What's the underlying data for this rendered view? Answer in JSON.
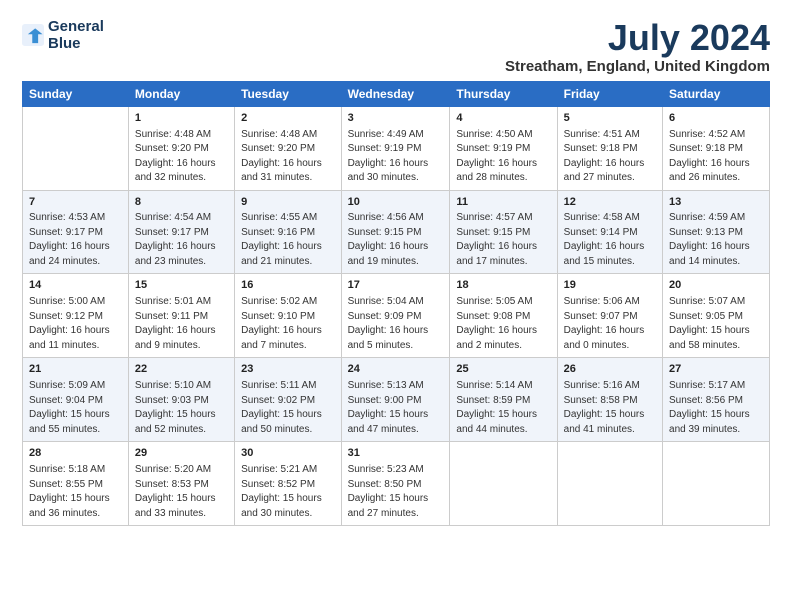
{
  "logo": {
    "line1": "General",
    "line2": "Blue"
  },
  "title": "July 2024",
  "location": "Streatham, England, United Kingdom",
  "days_of_week": [
    "Sunday",
    "Monday",
    "Tuesday",
    "Wednesday",
    "Thursday",
    "Friday",
    "Saturday"
  ],
  "weeks": [
    [
      {
        "day": "",
        "content": ""
      },
      {
        "day": "1",
        "content": "Sunrise: 4:48 AM\nSunset: 9:20 PM\nDaylight: 16 hours\nand 32 minutes."
      },
      {
        "day": "2",
        "content": "Sunrise: 4:48 AM\nSunset: 9:20 PM\nDaylight: 16 hours\nand 31 minutes."
      },
      {
        "day": "3",
        "content": "Sunrise: 4:49 AM\nSunset: 9:19 PM\nDaylight: 16 hours\nand 30 minutes."
      },
      {
        "day": "4",
        "content": "Sunrise: 4:50 AM\nSunset: 9:19 PM\nDaylight: 16 hours\nand 28 minutes."
      },
      {
        "day": "5",
        "content": "Sunrise: 4:51 AM\nSunset: 9:18 PM\nDaylight: 16 hours\nand 27 minutes."
      },
      {
        "day": "6",
        "content": "Sunrise: 4:52 AM\nSunset: 9:18 PM\nDaylight: 16 hours\nand 26 minutes."
      }
    ],
    [
      {
        "day": "7",
        "content": "Sunrise: 4:53 AM\nSunset: 9:17 PM\nDaylight: 16 hours\nand 24 minutes."
      },
      {
        "day": "8",
        "content": "Sunrise: 4:54 AM\nSunset: 9:17 PM\nDaylight: 16 hours\nand 23 minutes."
      },
      {
        "day": "9",
        "content": "Sunrise: 4:55 AM\nSunset: 9:16 PM\nDaylight: 16 hours\nand 21 minutes."
      },
      {
        "day": "10",
        "content": "Sunrise: 4:56 AM\nSunset: 9:15 PM\nDaylight: 16 hours\nand 19 minutes."
      },
      {
        "day": "11",
        "content": "Sunrise: 4:57 AM\nSunset: 9:15 PM\nDaylight: 16 hours\nand 17 minutes."
      },
      {
        "day": "12",
        "content": "Sunrise: 4:58 AM\nSunset: 9:14 PM\nDaylight: 16 hours\nand 15 minutes."
      },
      {
        "day": "13",
        "content": "Sunrise: 4:59 AM\nSunset: 9:13 PM\nDaylight: 16 hours\nand 14 minutes."
      }
    ],
    [
      {
        "day": "14",
        "content": "Sunrise: 5:00 AM\nSunset: 9:12 PM\nDaylight: 16 hours\nand 11 minutes."
      },
      {
        "day": "15",
        "content": "Sunrise: 5:01 AM\nSunset: 9:11 PM\nDaylight: 16 hours\nand 9 minutes."
      },
      {
        "day": "16",
        "content": "Sunrise: 5:02 AM\nSunset: 9:10 PM\nDaylight: 16 hours\nand 7 minutes."
      },
      {
        "day": "17",
        "content": "Sunrise: 5:04 AM\nSunset: 9:09 PM\nDaylight: 16 hours\nand 5 minutes."
      },
      {
        "day": "18",
        "content": "Sunrise: 5:05 AM\nSunset: 9:08 PM\nDaylight: 16 hours\nand 2 minutes."
      },
      {
        "day": "19",
        "content": "Sunrise: 5:06 AM\nSunset: 9:07 PM\nDaylight: 16 hours\nand 0 minutes."
      },
      {
        "day": "20",
        "content": "Sunrise: 5:07 AM\nSunset: 9:05 PM\nDaylight: 15 hours\nand 58 minutes."
      }
    ],
    [
      {
        "day": "21",
        "content": "Sunrise: 5:09 AM\nSunset: 9:04 PM\nDaylight: 15 hours\nand 55 minutes."
      },
      {
        "day": "22",
        "content": "Sunrise: 5:10 AM\nSunset: 9:03 PM\nDaylight: 15 hours\nand 52 minutes."
      },
      {
        "day": "23",
        "content": "Sunrise: 5:11 AM\nSunset: 9:02 PM\nDaylight: 15 hours\nand 50 minutes."
      },
      {
        "day": "24",
        "content": "Sunrise: 5:13 AM\nSunset: 9:00 PM\nDaylight: 15 hours\nand 47 minutes."
      },
      {
        "day": "25",
        "content": "Sunrise: 5:14 AM\nSunset: 8:59 PM\nDaylight: 15 hours\nand 44 minutes."
      },
      {
        "day": "26",
        "content": "Sunrise: 5:16 AM\nSunset: 8:58 PM\nDaylight: 15 hours\nand 41 minutes."
      },
      {
        "day": "27",
        "content": "Sunrise: 5:17 AM\nSunset: 8:56 PM\nDaylight: 15 hours\nand 39 minutes."
      }
    ],
    [
      {
        "day": "28",
        "content": "Sunrise: 5:18 AM\nSunset: 8:55 PM\nDaylight: 15 hours\nand 36 minutes."
      },
      {
        "day": "29",
        "content": "Sunrise: 5:20 AM\nSunset: 8:53 PM\nDaylight: 15 hours\nand 33 minutes."
      },
      {
        "day": "30",
        "content": "Sunrise: 5:21 AM\nSunset: 8:52 PM\nDaylight: 15 hours\nand 30 minutes."
      },
      {
        "day": "31",
        "content": "Sunrise: 5:23 AM\nSunset: 8:50 PM\nDaylight: 15 hours\nand 27 minutes."
      },
      {
        "day": "",
        "content": ""
      },
      {
        "day": "",
        "content": ""
      },
      {
        "day": "",
        "content": ""
      }
    ]
  ]
}
